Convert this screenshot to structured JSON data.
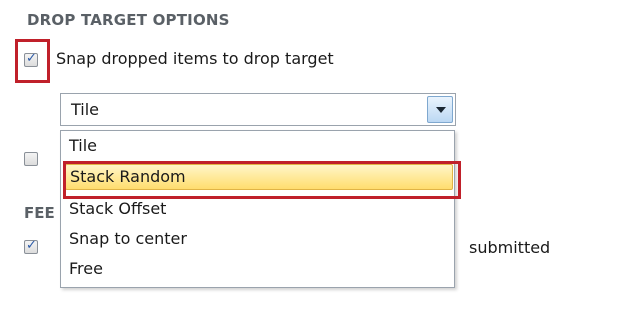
{
  "section": {
    "title": "DROP TARGET OPTIONS"
  },
  "snap_checkbox": {
    "checked": true,
    "label": "Snap dropped items to drop target"
  },
  "layout_select": {
    "value": "Tile",
    "options": [
      "Tile",
      "Stack Random",
      "Stack Offset",
      "Snap to center",
      "Free"
    ],
    "highlighted": "Stack Random"
  },
  "behind_dropdown": {
    "second_checkbox_checked": false,
    "section_title_partial": "FEE",
    "third_checkbox_checked": true,
    "trailing_text": "submitted"
  },
  "colors": {
    "annotation_red": "#c0202a",
    "highlight_yellow": "#ffdd6e",
    "check_blue": "#2b5aa8"
  },
  "icons": {
    "checkmark": "checkmark-icon",
    "dropdown_arrow": "chevron-down-icon"
  }
}
